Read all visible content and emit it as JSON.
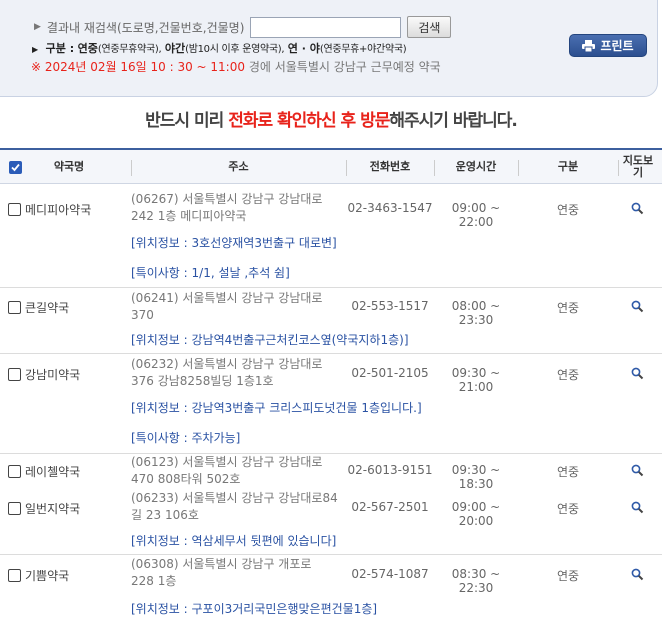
{
  "search": {
    "label": "결과내 재검색(도로명,건물번호,건물명)",
    "value": "",
    "placeholder": "",
    "button": "검색"
  },
  "legend": {
    "prefix": "구분 :",
    "t1": "연중",
    "t2": "(연중무휴약국),",
    "t3": "야간",
    "t4": "(밤10시 이후 운영약국),",
    "t5": "연 · 야",
    "t6": "(연중무휴+야간약국)"
  },
  "timeline": {
    "red": "※ 2024년 02월 16일 10 : 30 ~ 11:00",
    "grey": " 경에  서울특별시  강남구   근무예정 약국"
  },
  "print_button": "프린트",
  "notice": {
    "a": "반드시 미리 ",
    "b": "전화로 확인하신 후 방문",
    "c": "해주시기 바랍니다."
  },
  "table": {
    "headers": [
      "약국명",
      "주소",
      "전화번호",
      "운영시간",
      "구분",
      "지도보기"
    ],
    "rows": [
      {
        "name": "메디피아약국",
        "addr1": "(06267) 서울특별시 강남구 강남대로",
        "addr2": "242 1층 메디피아약국",
        "phone": "02-3463-1547",
        "hours": "09:00 ~ 22:00",
        "kind": "연중",
        "info1": "[위치정보 : 3호선양재역3번출구 대로변]",
        "info2": "[특이사항 : 1/1, 설날 ,추석 쉼]"
      },
      {
        "name": "큰길약국",
        "addr1": "(06241) 서울특별시 강남구 강남대로",
        "addr2": "370",
        "phone": "02-553-1517",
        "hours": "08:00 ~ 23:30",
        "kind": "연중",
        "info1": "[위치정보 : 강남역4번출구근처킨코스옆(약국지하1층)]",
        "info2": ""
      },
      {
        "name": "강남미약국",
        "addr1": "(06232) 서울특별시 강남구 강남대로",
        "addr2": "376 강남8258빌딩 1층1호",
        "phone": "02-501-2105",
        "hours": "09:30 ~ 21:00",
        "kind": "연중",
        "info1": "[위치정보 : 강남역3번출구 크리스피도넛건물 1층입니다.]",
        "info2": "[특이사항 : 주차가능]"
      },
      {
        "name": "레이첼약국",
        "addr1": "(06123) 서울특별시 강남구 강남대로",
        "addr2": "470 808타워 502호",
        "phone": "02-6013-9151",
        "hours": "09:30 ~ 18:30",
        "kind": "연중",
        "info1": "",
        "info2": ""
      },
      {
        "name": "일번지약국",
        "addr1": "(06233) 서울특별시 강남구 강남대로84",
        "addr2": "길 23 106호",
        "phone": "02-567-2501",
        "hours": "09:00 ~ 20:00",
        "kind": "연중",
        "info1": "[위치정보 : 역삼세무서 뒷편에 있습니다]",
        "info2": ""
      },
      {
        "name": "기쁨약국",
        "addr1": "(06308) 서울특별시 강남구 개포로",
        "addr2": "228 1층",
        "phone": "02-574-1087",
        "hours": "08:30 ~ 22:30",
        "kind": "연중",
        "info1": "[위치정보 : 구포이3거리국민은행맞은편건물1층]",
        "info2": ""
      }
    ]
  },
  "icons": {
    "map": "magnifier-icon",
    "print": "printer-icon"
  }
}
